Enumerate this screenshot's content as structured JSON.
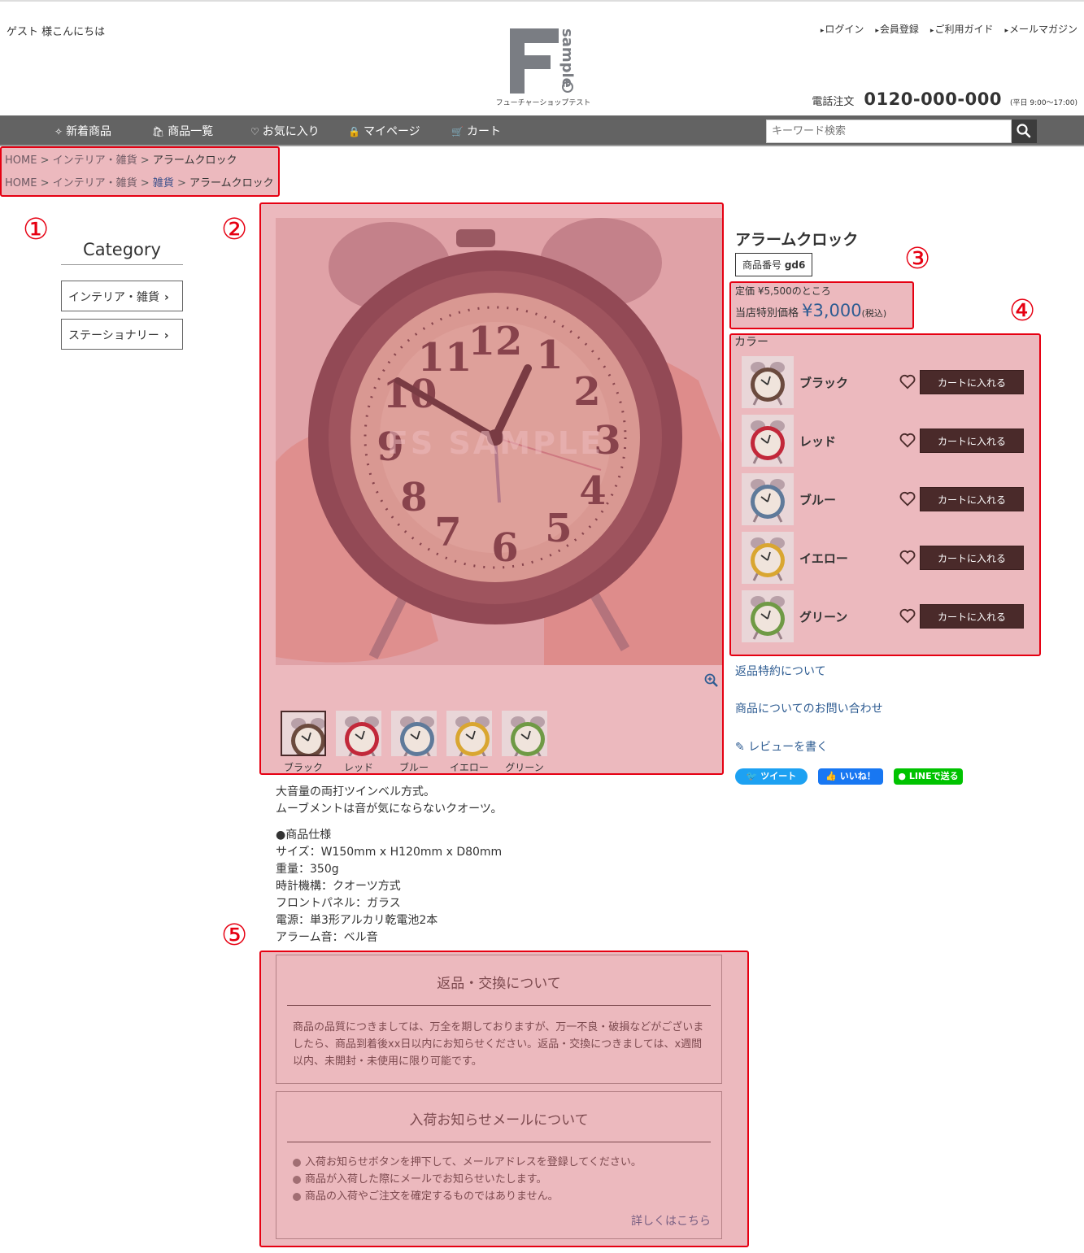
{
  "header": {
    "greeting": "ゲスト 様こんにちは",
    "logo_letter": "F",
    "logo_word": "sample",
    "logo_subtitle": "フューチャーショップテスト",
    "links": [
      "ログイン",
      "会員登録",
      "ご利用ガイド",
      "メールマガジン"
    ],
    "phone_label": "電話注文",
    "phone_number": "0120-000-000",
    "phone_hours": "(平日 9:00～17:00)"
  },
  "nav": {
    "items": [
      {
        "label": "新着商品",
        "icon": "sparkle-icon"
      },
      {
        "label": "商品一覧",
        "icon": "bag-icon"
      },
      {
        "label": "お気に入り",
        "icon": "heart-icon"
      },
      {
        "label": "マイページ",
        "icon": "lock-icon"
      },
      {
        "label": "カート",
        "icon": "cart-icon"
      }
    ],
    "search_placeholder": "キーワード検索"
  },
  "breadcrumbs": [
    [
      "HOME",
      "インテリア・雑貨",
      "アラームクロック"
    ],
    [
      "HOME",
      "インテリア・雑貨",
      "雑貨",
      "アラームクロック"
    ]
  ],
  "crumb_sep": ">",
  "markers": [
    "①",
    "②",
    "③",
    "④",
    "⑤"
  ],
  "sidebar": {
    "title": "Category",
    "items": [
      "インテリア・雑貨",
      "ステーショナリー"
    ]
  },
  "gallery": {
    "watermark": "FS SAMPLE",
    "thumbs": [
      "ブラック",
      "レッド",
      "ブルー",
      "イエロー",
      "グリーン"
    ]
  },
  "product": {
    "title": "アラームクロック",
    "code_label": "商品番号",
    "code": "gd6",
    "list_price": "定価 ¥5,500のところ",
    "sale_label": "当店特別価格",
    "sale_price": "¥3,000",
    "tax": "(税込)",
    "color_label": "カラー",
    "variants": [
      {
        "name": "ブラック",
        "button": "カートに入れる",
        "color": "#6b4a3e"
      },
      {
        "name": "レッド",
        "button": "カートに入れる",
        "color": "#c2283a"
      },
      {
        "name": "ブルー",
        "button": "カートに入れる",
        "color": "#5f7a9a"
      },
      {
        "name": "イエロー",
        "button": "カートに入れる",
        "color": "#d9a631"
      },
      {
        "name": "グリーン",
        "button": "カートに入れる",
        "color": "#6f9a45"
      }
    ],
    "links": [
      "返品特約について",
      "商品についてのお問い合わせ",
      "レビューを書く"
    ],
    "sns": [
      "ツイート",
      "いいね！",
      "LINEで送る"
    ]
  },
  "description": {
    "lines1": [
      "大音量の両打ツインベル方式。",
      "ムーブメントは音が気にならないクオーツ。"
    ],
    "lines2": [
      "●商品仕様",
      "サイズ：W150mm x H120mm x D80mm",
      "重量：350g",
      "時計機構：クオーツ方式",
      "フロントパネル：ガラス",
      "電源：単3形アルカリ乾電池2本",
      "アラーム音：ベル音"
    ]
  },
  "returns_box": {
    "title": "返品・交換について",
    "body": "商品の品質につきましては、万全を期しておりますが、万一不良・破損などがございましたら、商品到着後xx日以内にお知らせください。返品・交換につきましては、x週間以内、未開封・未使用に限り可能です。"
  },
  "notify_box": {
    "title": "入荷お知らせメールについて",
    "bullets": [
      "入荷お知らせボタンを押下して、メールアドレスを登録してください。",
      "商品が入荷した際にメールでお知らせいたします。",
      "商品の入荷やご注文を確定するものではありません。"
    ],
    "more_link": "詳しくはこちら"
  },
  "colors": {
    "nav_bg": "#636363",
    "highlight_border": "#e60012",
    "price_blue": "#2e5c92",
    "cart_button": "#4a2a2a"
  }
}
